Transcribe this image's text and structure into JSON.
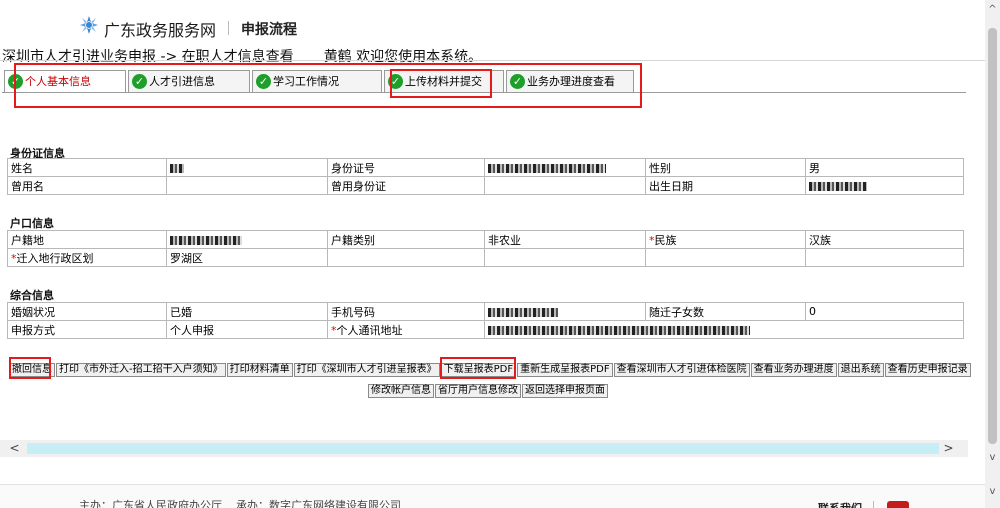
{
  "header": {
    "site_title": "广东政务服务网",
    "sub_title": "申报流程"
  },
  "breadcrumb": {
    "path": "深圳市人才引进业务申报 -> 在职人才信息查看",
    "greeting": "黄鹤 欢迎您使用本系统。"
  },
  "tabs": [
    {
      "label": "个人基本信息",
      "active": true
    },
    {
      "label": "人才引进信息",
      "active": false
    },
    {
      "label": "学习工作情况",
      "active": false
    },
    {
      "label": "上传材料并提交",
      "active": false
    },
    {
      "label": "业务办理进度查看",
      "active": false
    }
  ],
  "sections": {
    "id_info": {
      "title": "身份证信息",
      "rows": [
        {
          "l1": "姓名",
          "v1": "",
          "l2": "身份证号",
          "v2": "",
          "l3": "性别",
          "v3": "男"
        },
        {
          "l1": "曾用名",
          "v1": "",
          "l2": "曾用身份证",
          "v2": "",
          "l3": "出生日期",
          "v3": ""
        }
      ]
    },
    "hukou_info": {
      "title": "户口信息",
      "rows": [
        {
          "l1": "户籍地",
          "v1": "",
          "l2": "户籍类别",
          "v2": "非农业",
          "l3": "民族",
          "v3": "汉族"
        },
        {
          "l1": "迁入地行政区划",
          "v1": "罗湖区",
          "l2": "",
          "v2": "",
          "l3": "",
          "v3": ""
        }
      ]
    },
    "general_info": {
      "title": "综合信息",
      "rows": [
        {
          "l1": "婚姻状况",
          "v1": "已婚",
          "l2": "手机号码",
          "v2": "",
          "l3": "随迁子女数",
          "v3": "0"
        },
        {
          "l1": "申报方式",
          "v1": "个人申报",
          "l2": "个人通讯地址",
          "v2": "",
          "l3": "",
          "v3": ""
        }
      ]
    }
  },
  "required_mark": "*",
  "buttons_row1": [
    "撤回信息",
    "打印《市外迁入-招工招干入户须知》",
    "打印材料清单",
    "打印《深圳市人才引进呈报表》",
    "下载呈报表PDF",
    "重新生成呈报表PDF",
    "查看深圳市人才引进体检医院",
    "查看业务办理进度",
    "退出系统",
    "查看历史申报记录"
  ],
  "buttons_row2": [
    "修改帐户信息",
    "省厅用户信息修改",
    "返回选择申报页面"
  ],
  "scroll": {
    "left_arrow": "<",
    "right_arrow": ">",
    "up_arrow": "^",
    "down_arrow": "v"
  },
  "footer": {
    "host": "主办：广东省人民政府办公厅",
    "undertaker": "承办：数字广东网络建设有限公司",
    "contact": "联系我们"
  },
  "colors": {
    "highlight_box": "#e41b1b",
    "check": "#1d9f2a",
    "active_tab": "#c80000",
    "scroll_thumb": "#c7eef5"
  }
}
